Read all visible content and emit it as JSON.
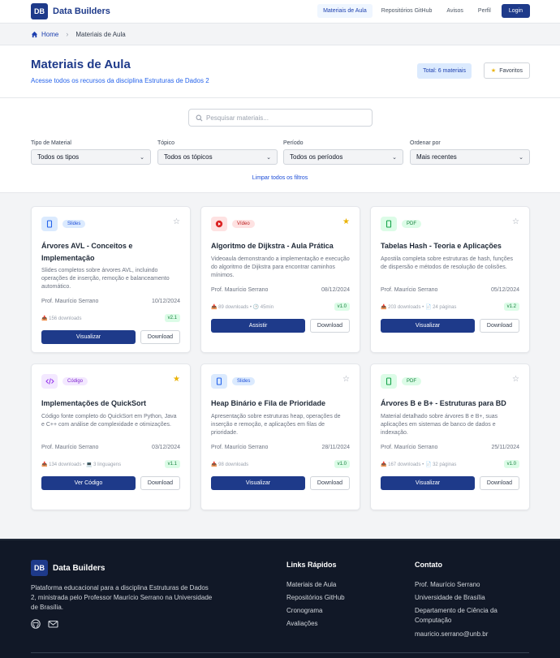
{
  "nav": {
    "logo": "DB",
    "brand": "Data Builders",
    "links": [
      "Materiais de Aula",
      "Repositórios GitHub",
      "Avisos",
      "Perfil"
    ],
    "login": "Login"
  },
  "breadcrumb": {
    "home": "Home",
    "current": "Materiais de Aula"
  },
  "header": {
    "title": "Materiais de Aula",
    "subtitle": "Acesse todos os recursos da disciplina Estruturas de Dados 2",
    "total": "Total: 6 materiais",
    "favorites": "Favoritos"
  },
  "filters": {
    "search_placeholder": "Pesquisar materiais...",
    "type_label": "Tipo de Material",
    "type_value": "Todos os tipos",
    "topic_label": "Tópico",
    "topic_value": "Todos os tópicos",
    "period_label": "Período",
    "period_value": "Todos os períodos",
    "order_label": "Ordenar por",
    "order_value": "Mais recentes",
    "clear": "Limpar todos os filtros"
  },
  "cards": [
    {
      "type": "Slides",
      "title": "Árvores AVL - Conceitos e Implementação",
      "desc": "Slides completos sobre árvores AVL, incluindo operações de inserção, remoção e balanceamento automático.",
      "author": "Prof. Maurício Serrano",
      "date": "10/12/2024",
      "stats": "📥 156 downloads",
      "version": "v2.1",
      "primary": "Visualizar",
      "secondary": "Download",
      "favorite": false,
      "icon": "slides-icon",
      "icon_color": "#2563eb",
      "icon_bg": "#dbeafe",
      "badge_bg": "#dbeafe",
      "badge_color": "#1d4ed8"
    },
    {
      "type": "Vídeo",
      "title": "Algoritmo de Dijkstra - Aula Prática",
      "desc": "Videoaula demonstrando a implementação e execução do algoritmo de Dijkstra para encontrar caminhos mínimos.",
      "author": "Prof. Maurício Serrano",
      "date": "08/12/2024",
      "stats": "📥 89 downloads • 🕒 45min",
      "version": "v1.0",
      "primary": "Assistir",
      "secondary": "Download",
      "favorite": true,
      "icon": "play-icon",
      "icon_color": "#dc2626",
      "icon_bg": "#fee2e2",
      "badge_bg": "#fee2e2",
      "badge_color": "#b91c1c"
    },
    {
      "type": "PDF",
      "title": "Tabelas Hash - Teoria e Aplicações",
      "desc": "Apostila completa sobre estruturas de hash, funções de dispersão e métodos de resolução de colisões.",
      "author": "Prof. Maurício Serrano",
      "date": "05/12/2024",
      "stats": "📥 203 downloads • 📄 24 páginas",
      "version": "v1.2",
      "primary": "Visualizar",
      "secondary": "Download",
      "favorite": false,
      "icon": "pdf-icon",
      "icon_color": "#16a34a",
      "icon_bg": "#dcfce7",
      "badge_bg": "#dcfce7",
      "badge_color": "#15803d"
    },
    {
      "type": "Código",
      "title": "Implementações de QuickSort",
      "desc": "Código fonte completo do QuickSort em Python, Java e C++ com análise de complexidade e otimizações.",
      "author": "Prof. Maurício Serrano",
      "date": "03/12/2024",
      "stats": "📥 134 downloads • 💻 3 linguagens",
      "version": "v1.1",
      "primary": "Ver Código",
      "secondary": "Download",
      "favorite": true,
      "icon": "code-icon",
      "icon_color": "#9333ea",
      "icon_bg": "#f3e8ff",
      "badge_bg": "#f3e8ff",
      "badge_color": "#7e22ce"
    },
    {
      "type": "Slides",
      "title": "Heap Binário e Fila de Prioridade",
      "desc": "Apresentação sobre estruturas heap, operações de inserção e remoção, e aplicações em filas de prioridade.",
      "author": "Prof. Maurício Serrano",
      "date": "28/11/2024",
      "stats": "📥 98 downloads",
      "version": "v1.0",
      "primary": "Visualizar",
      "secondary": "Download",
      "favorite": false,
      "icon": "slides-icon",
      "icon_color": "#2563eb",
      "icon_bg": "#dbeafe",
      "badge_bg": "#dbeafe",
      "badge_color": "#1d4ed8"
    },
    {
      "type": "PDF",
      "title": "Árvores B e B+ - Estruturas para BD",
      "desc": "Material detalhado sobre árvores B e B+, suas aplicações em sistemas de banco de dados e indexação.",
      "author": "Prof. Maurício Serrano",
      "date": "25/11/2024",
      "stats": "📥 167 downloads • 📄 32 páginas",
      "version": "v1.0",
      "primary": "Visualizar",
      "secondary": "Download",
      "favorite": false,
      "icon": "pdf-icon",
      "icon_color": "#16a34a",
      "icon_bg": "#dcfce7",
      "badge_bg": "#dcfce7",
      "badge_color": "#15803d"
    }
  ],
  "footer": {
    "logo": "DB",
    "brand": "Data Builders",
    "desc": "Plataforma educacional para a disciplina Estruturas de Dados 2, ministrada pelo Professor Maurício Serrano na Universidade de Brasília.",
    "links_title": "Links Rápidos",
    "links": [
      "Materiais de Aula",
      "Repositórios GitHub",
      "Cronograma",
      "Avaliações"
    ],
    "contact_title": "Contato",
    "contact": [
      "Prof. Maurício Serrano",
      "Universidade de Brasília",
      "Departamento de Ciência da Computação",
      "mauricio.serrano@unb.br"
    ]
  }
}
